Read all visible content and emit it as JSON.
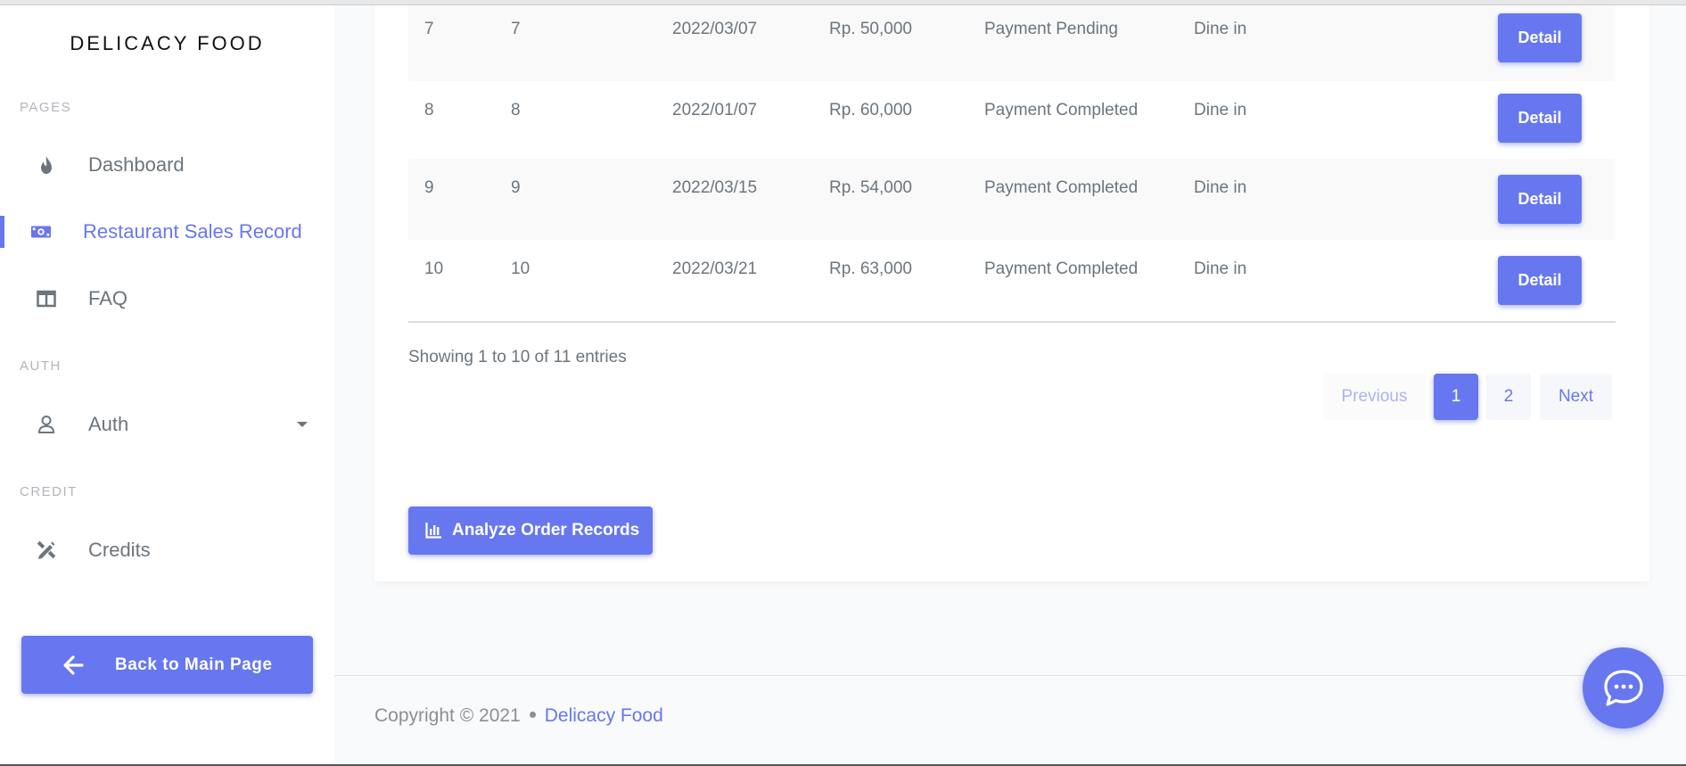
{
  "sidebar": {
    "brand": "DELICACY FOOD",
    "sections": {
      "pages": "PAGES",
      "auth": "AUTH",
      "credit": "CREDIT"
    },
    "items": [
      {
        "label": "Dashboard",
        "icon": "fire-icon",
        "active": false
      },
      {
        "label": "Restaurant Sales Record",
        "icon": "money-bill-icon",
        "active": true
      },
      {
        "label": "FAQ",
        "icon": "columns-icon",
        "active": false
      },
      {
        "label": "Auth",
        "icon": "user-icon",
        "active": false
      },
      {
        "label": "Credits",
        "icon": "pencil-ruler-icon",
        "active": false
      }
    ],
    "back_button": "Back to Main Page"
  },
  "table": {
    "rows": [
      {
        "no": "7",
        "id": "7",
        "date": "2022/03/07",
        "total": "Rp. 50,000",
        "status": "Payment Pending",
        "type": "Dine in",
        "action": "Detail"
      },
      {
        "no": "8",
        "id": "8",
        "date": "2022/01/07",
        "total": "Rp. 60,000",
        "status": "Payment Completed",
        "type": "Dine in",
        "action": "Detail"
      },
      {
        "no": "9",
        "id": "9",
        "date": "2022/03/15",
        "total": "Rp. 54,000",
        "status": "Payment Completed",
        "type": "Dine in",
        "action": "Detail"
      },
      {
        "no": "10",
        "id": "10",
        "date": "2022/03/21",
        "total": "Rp. 63,000",
        "status": "Payment Completed",
        "type": "Dine in",
        "action": "Detail"
      }
    ],
    "info": "Showing 1 to 10 of 11 entries",
    "pagination": {
      "previous": "Previous",
      "pages": [
        "1",
        "2"
      ],
      "current": "1",
      "next": "Next"
    }
  },
  "analyze_button": "Analyze Order Records",
  "footer": {
    "copyright": "Copyright © 2021",
    "link": "Delicacy Food"
  },
  "colors": {
    "accent": "#6777ef",
    "text": "#6c757d",
    "background": "#f9fafb"
  }
}
